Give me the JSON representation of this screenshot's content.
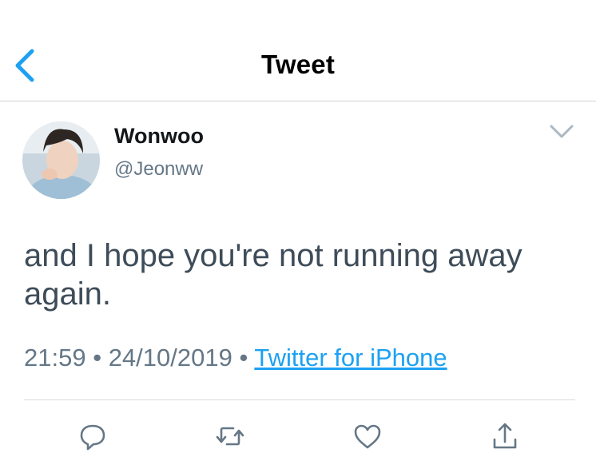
{
  "header": {
    "title": "Tweet"
  },
  "tweet": {
    "author_name": "Wonwoo",
    "author_handle": "@Jeonww",
    "text": "and I hope you're not running away again.",
    "time": "21:59",
    "date": "24/10/2019",
    "separator": "•",
    "source": "Twitter for iPhone"
  },
  "actions": [
    {
      "name": "reply",
      "icon": "reply-icon"
    },
    {
      "name": "retweet",
      "icon": "retweet-icon"
    },
    {
      "name": "like",
      "icon": "heart-icon"
    },
    {
      "name": "share",
      "icon": "share-icon"
    }
  ],
  "colors": {
    "accent": "#1da1f2",
    "secondary_text": "#657786",
    "divider": "#cfd4d8"
  }
}
